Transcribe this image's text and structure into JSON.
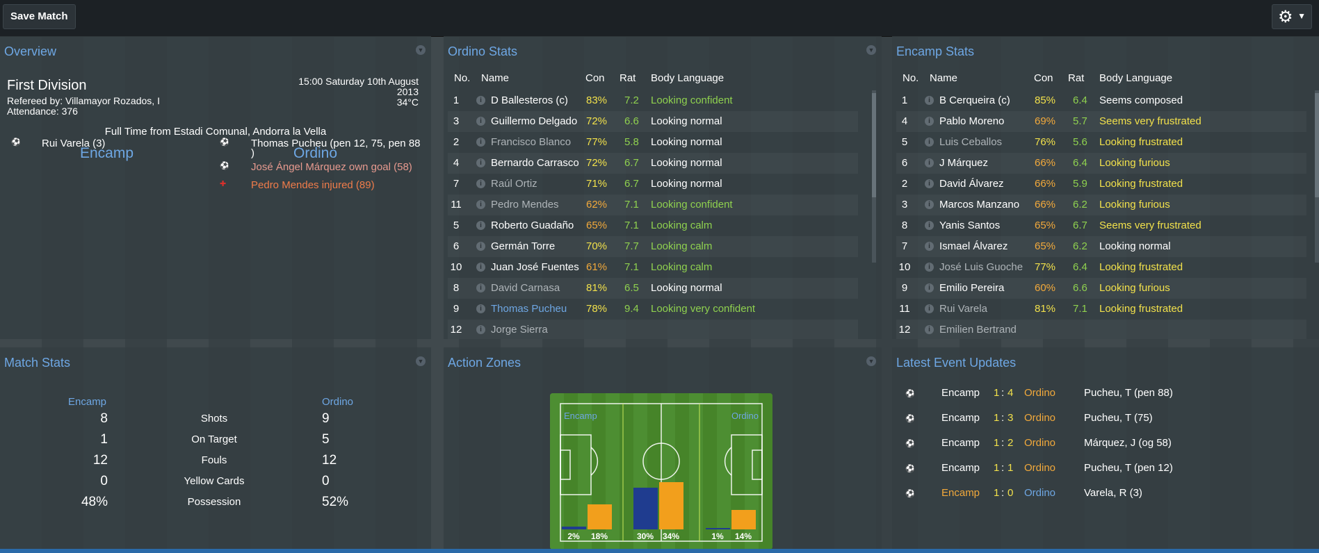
{
  "toolbar": {
    "save_label": "Save Match",
    "settings_icon": "gear-icon"
  },
  "overview": {
    "title": "Overview",
    "competition": "First Division",
    "referee": "Refereed by: Villamayor Rozados, I",
    "attendance": "Attendance: 376",
    "datetime_line1": "15:00 Saturday 10th August",
    "datetime_line2": "2013",
    "temperature": "34°C",
    "fulltime": "Full Time from Estadi Comunal, Andorra la Vella",
    "home": "Encamp",
    "away": "Ordino",
    "home_events": [
      {
        "icon": "ball-icon",
        "text": "Rui Varela (3)"
      }
    ],
    "away_events": [
      {
        "icon": "ball-icon",
        "text": "Thomas Pucheu (pen 12, 75, pen 88",
        "text2": ")"
      },
      {
        "icon": "own-goal-icon",
        "text": "José Ángel Márquez own goal (58)"
      },
      {
        "icon": "injury-icon",
        "text": "Pedro Mendes injured (89)"
      }
    ]
  },
  "ordino_stats": {
    "title": "Ordino Stats",
    "headers": {
      "no": "No.",
      "name": "Name",
      "con": "Con",
      "rat": "Rat",
      "body": "Body Language"
    },
    "rows": [
      {
        "no": "1",
        "name": "D Ballesteros (c)",
        "con": "83%",
        "rat": "7.2",
        "body": "Looking confident",
        "name_color": "#ffffff",
        "con_color": "#f2e14b",
        "body_color": "#8fd14f"
      },
      {
        "no": "3",
        "name": "Guillermo Delgado",
        "con": "72%",
        "rat": "6.6",
        "body": "Looking normal",
        "name_color": "#ffffff",
        "con_color": "#f2e14b",
        "body_color": "#ffffff"
      },
      {
        "no": "2",
        "name": "Francisco Blanco",
        "con": "77%",
        "rat": "5.8",
        "body": "Looking normal",
        "name_color": "#aeb4b8",
        "con_color": "#f2e14b",
        "body_color": "#ffffff"
      },
      {
        "no": "4",
        "name": "Bernardo Carrasco",
        "con": "72%",
        "rat": "6.7",
        "body": "Looking normal",
        "name_color": "#ffffff",
        "con_color": "#f2e14b",
        "body_color": "#ffffff"
      },
      {
        "no": "7",
        "name": "Raúl Ortiz",
        "con": "71%",
        "rat": "6.7",
        "body": "Looking normal",
        "name_color": "#aeb4b8",
        "con_color": "#f2e14b",
        "body_color": "#ffffff"
      },
      {
        "no": "11",
        "name": "Pedro Mendes",
        "con": "62%",
        "rat": "7.1",
        "body": "Looking confident",
        "name_color": "#aeb4b8",
        "con_color": "#f2a93b",
        "body_color": "#8fd14f"
      },
      {
        "no": "5",
        "name": "Roberto Guadaño",
        "con": "65%",
        "rat": "7.1",
        "body": "Looking calm",
        "name_color": "#ffffff",
        "con_color": "#f2a93b",
        "body_color": "#8fd14f"
      },
      {
        "no": "6",
        "name": "Germán Torre",
        "con": "70%",
        "rat": "7.7",
        "body": "Looking calm",
        "name_color": "#ffffff",
        "con_color": "#f2e14b",
        "body_color": "#8fd14f"
      },
      {
        "no": "10",
        "name": "Juan José Fuentes",
        "con": "61%",
        "rat": "7.1",
        "body": "Looking calm",
        "name_color": "#ffffff",
        "con_color": "#f2a93b",
        "body_color": "#8fd14f"
      },
      {
        "no": "8",
        "name": "David Carnasa",
        "con": "81%",
        "rat": "6.5",
        "body": "Looking normal",
        "name_color": "#aeb4b8",
        "con_color": "#f2e14b",
        "body_color": "#ffffff"
      },
      {
        "no": "9",
        "name": "Thomas Pucheu",
        "con": "78%",
        "rat": "9.4",
        "body": "Looking very confident",
        "name_color": "#6ea7e4",
        "con_color": "#f2e14b",
        "body_color": "#8fd14f"
      },
      {
        "no": "12",
        "name": "Jorge Sierra",
        "con": "",
        "rat": "",
        "body": "",
        "name_color": "#aeb4b8",
        "con_color": "#f2e14b",
        "body_color": "#ffffff"
      }
    ]
  },
  "encamp_stats": {
    "title": "Encamp Stats",
    "headers": {
      "no": "No.",
      "name": "Name",
      "con": "Con",
      "rat": "Rat",
      "body": "Body Language"
    },
    "rows": [
      {
        "no": "1",
        "name": "B Cerqueira (c)",
        "con": "85%",
        "rat": "6.4",
        "body": "Seems composed",
        "name_color": "#ffffff",
        "con_color": "#f2e14b",
        "body_color": "#ffffff"
      },
      {
        "no": "4",
        "name": "Pablo Moreno",
        "con": "69%",
        "rat": "5.7",
        "body": "Seems very frustrated",
        "name_color": "#ffffff",
        "con_color": "#f2a93b",
        "body_color": "#f2e14b"
      },
      {
        "no": "5",
        "name": "Luis Ceballos",
        "con": "76%",
        "rat": "5.6",
        "body": "Looking frustrated",
        "name_color": "#aeb4b8",
        "con_color": "#f2e14b",
        "body_color": "#f2e14b"
      },
      {
        "no": "6",
        "name": "J Márquez",
        "con": "66%",
        "rat": "6.4",
        "body": "Looking furious",
        "name_color": "#ffffff",
        "con_color": "#f2a93b",
        "body_color": "#f2e14b"
      },
      {
        "no": "2",
        "name": "David Álvarez",
        "con": "66%",
        "rat": "5.9",
        "body": "Looking frustrated",
        "name_color": "#ffffff",
        "con_color": "#f2a93b",
        "body_color": "#f2e14b"
      },
      {
        "no": "3",
        "name": "Marcos Manzano",
        "con": "66%",
        "rat": "6.2",
        "body": "Looking furious",
        "name_color": "#ffffff",
        "con_color": "#f2a93b",
        "body_color": "#f2e14b"
      },
      {
        "no": "8",
        "name": "Yanis Santos",
        "con": "65%",
        "rat": "6.7",
        "body": "Seems very frustrated",
        "name_color": "#ffffff",
        "con_color": "#f2a93b",
        "body_color": "#f2e14b"
      },
      {
        "no": "7",
        "name": "Ismael Álvarez",
        "con": "65%",
        "rat": "6.2",
        "body": "Looking normal",
        "name_color": "#ffffff",
        "con_color": "#f2a93b",
        "body_color": "#ffffff"
      },
      {
        "no": "10",
        "name": "José Luis Guoche",
        "con": "77%",
        "rat": "6.4",
        "body": "Looking frustrated",
        "name_color": "#aeb4b8",
        "con_color": "#f2e14b",
        "body_color": "#f2e14b"
      },
      {
        "no": "9",
        "name": "Emilio Pereira",
        "con": "60%",
        "rat": "6.6",
        "body": "Looking furious",
        "name_color": "#ffffff",
        "con_color": "#f2a93b",
        "body_color": "#f2e14b"
      },
      {
        "no": "11",
        "name": "Rui Varela",
        "con": "81%",
        "rat": "7.1",
        "body": "Looking frustrated",
        "name_color": "#aeb4b8",
        "con_color": "#f2e14b",
        "body_color": "#f2e14b"
      },
      {
        "no": "12",
        "name": "Emilien Bertrand",
        "con": "",
        "rat": "",
        "body": "",
        "name_color": "#aeb4b8",
        "con_color": "#f2e14b",
        "body_color": "#ffffff"
      }
    ]
  },
  "match_stats": {
    "title": "Match Stats",
    "home": "Encamp",
    "away": "Ordino",
    "rows": [
      {
        "label": "Shots",
        "home": "8",
        "away": "9"
      },
      {
        "label": "On Target",
        "home": "1",
        "away": "5"
      },
      {
        "label": "Fouls",
        "home": "12",
        "away": "12"
      },
      {
        "label": "Yellow Cards",
        "home": "0",
        "away": "0"
      },
      {
        "label": "Possession",
        "home": "48%",
        "away": "52%"
      }
    ]
  },
  "action_zones": {
    "title": "Action Zones",
    "home": "Encamp",
    "away": "Ordino",
    "zones": [
      {
        "home_label": "2%",
        "away_label": "18%",
        "home": 2,
        "away": 18
      },
      {
        "home_label": "30%",
        "away_label": "34%",
        "home": 30,
        "away": 34
      },
      {
        "home_label": "1%",
        "away_label": "14%",
        "home": 1,
        "away": 14
      }
    ],
    "home_color": "#1f3c8f",
    "away_color": "#f29f1c"
  },
  "latest_events": {
    "title": "Latest Event Updates",
    "rows": [
      {
        "icon": "ball-icon",
        "home": "Encamp",
        "hs": "1",
        "sep": ":",
        "as": "4",
        "away": "Ordino",
        "desc": "Pucheu, T (pen 88)",
        "highlight": "away"
      },
      {
        "icon": "ball-icon",
        "home": "Encamp",
        "hs": "1",
        "sep": ":",
        "as": "3",
        "away": "Ordino",
        "desc": "Pucheu, T (75)",
        "highlight": "away"
      },
      {
        "icon": "own-goal-icon",
        "home": "Encamp",
        "hs": "1",
        "sep": ":",
        "as": "2",
        "away": "Ordino",
        "desc": "Márquez, J (og 58)",
        "highlight": "away"
      },
      {
        "icon": "ball-icon",
        "home": "Encamp",
        "hs": "1",
        "sep": ":",
        "as": "1",
        "away": "Ordino",
        "desc": "Pucheu, T (pen 12)",
        "highlight": "away"
      },
      {
        "icon": "ball-icon",
        "home": "Encamp",
        "hs": "1",
        "sep": ":",
        "as": "0",
        "away": "Ordino",
        "desc": "Varela, R (3)",
        "highlight": "home"
      }
    ]
  }
}
